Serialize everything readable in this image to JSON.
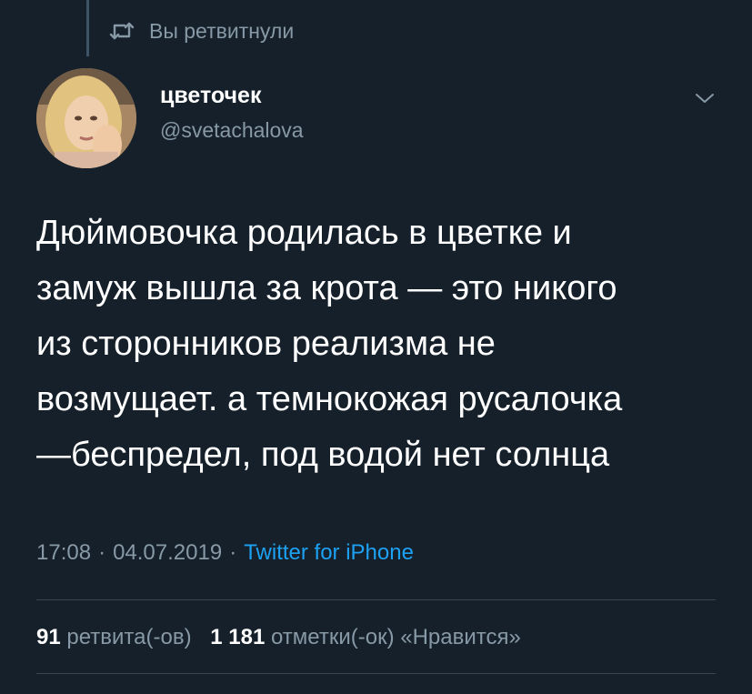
{
  "retweet": {
    "icon": "retweet-icon",
    "label": "Вы ретвитнули"
  },
  "author": {
    "avatar": "avatar-photo",
    "display_name": "цветочек",
    "handle": "@svetachalova"
  },
  "menu": {
    "icon": "chevron-down-icon"
  },
  "tweet": {
    "lines": [
      "Дюймовочка родилась в цветке и",
      "замуж вышла за крота — это никого",
      "из сторонников реализма не",
      "возмущает. а темнокожая русалочка",
      "—беспредел, под водой нет солнца"
    ]
  },
  "meta": {
    "time": "17:08",
    "separator": "·",
    "date": "04.07.2019",
    "source": "Twitter for iPhone"
  },
  "stats": {
    "retweets_count": "91",
    "retweets_label": "ретвита(-ов)",
    "likes_count": "1 181",
    "likes_label": "отметки(-ок) «Нравится»"
  },
  "colors": {
    "background": "#15202b",
    "primary_text": "#ffffff",
    "secondary_text": "#8899a6",
    "link": "#1da1f2",
    "divider": "#38444d"
  }
}
